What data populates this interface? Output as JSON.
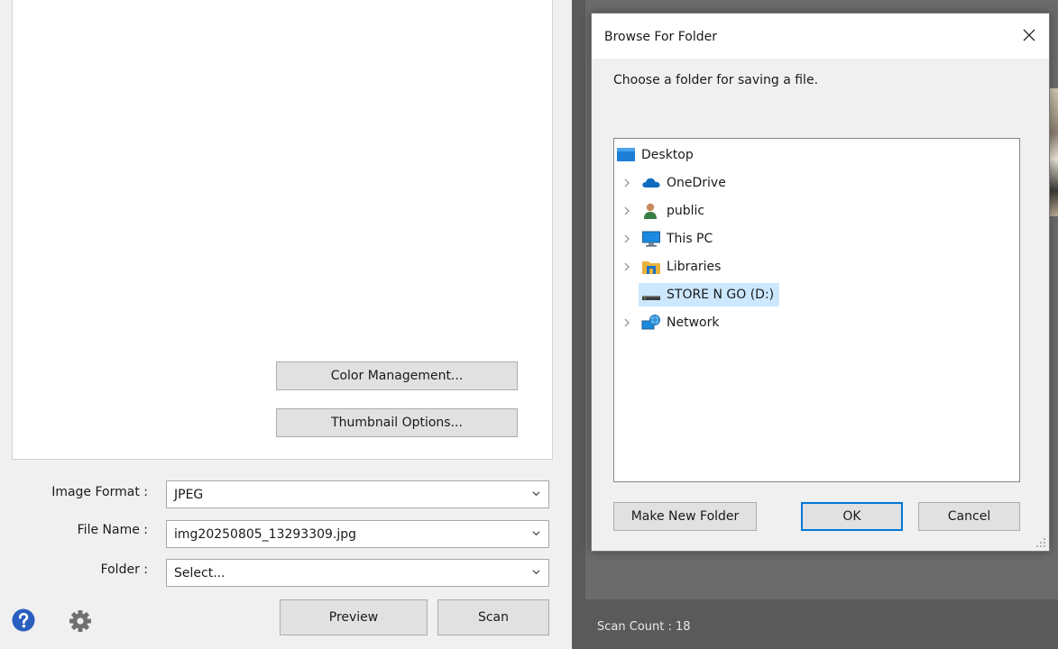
{
  "settings": {
    "color_management_label": "Color Management...",
    "thumbnail_options_label": "Thumbnail Options...",
    "image_format": {
      "label": "Image Format :",
      "value": "JPEG"
    },
    "file_name": {
      "label": "File Name :",
      "value": "img20250805_13293309.jpg"
    },
    "folder": {
      "label": "Folder :",
      "value": "Select..."
    },
    "preview_label": "Preview",
    "scan_label": "Scan",
    "help_icon": "question-mark-circle-icon",
    "settings_icon": "gear-icon"
  },
  "status": {
    "scan_count": "Scan Count : 18"
  },
  "dialog": {
    "title": "Browse For Folder",
    "instruction": "Choose a folder for saving a file.",
    "tree": [
      {
        "label": "Desktop",
        "icon": "desktop-icon",
        "expandable": false,
        "selected": false
      },
      {
        "label": "OneDrive",
        "icon": "cloud-icon",
        "expandable": true,
        "selected": false
      },
      {
        "label": "public",
        "icon": "user-icon",
        "expandable": true,
        "selected": false
      },
      {
        "label": "This PC",
        "icon": "monitor-icon",
        "expandable": true,
        "selected": false
      },
      {
        "label": "Libraries",
        "icon": "library-folder-icon",
        "expandable": true,
        "selected": false
      },
      {
        "label": "STORE N GO (D:)",
        "icon": "usb-drive-icon",
        "expandable": false,
        "selected": true
      },
      {
        "label": "Network",
        "icon": "network-icon",
        "expandable": true,
        "selected": false
      }
    ],
    "make_new_folder_label": "Make New Folder",
    "ok_label": "OK",
    "cancel_label": "Cancel"
  },
  "colors": {
    "selection": "#cce8ff",
    "help_blue": "#2b5fbf",
    "viewer_background": "#5a5a5a"
  }
}
